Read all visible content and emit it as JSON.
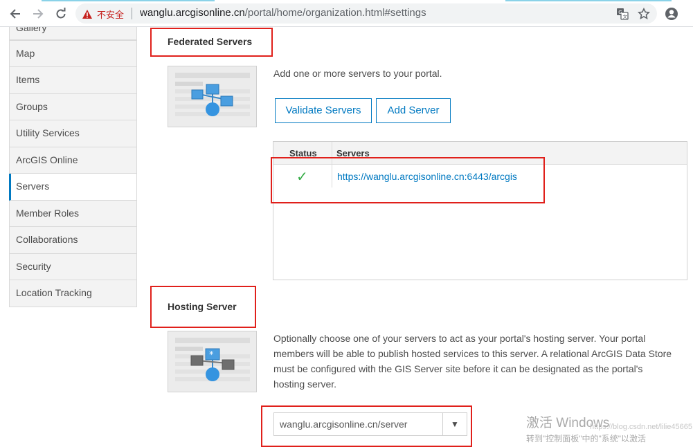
{
  "browser": {
    "security_label": "不安全",
    "url_host": "wanglu.arcgisonline.cn",
    "url_path": "/portal/home/organization.html#settings",
    "icons": [
      "back-icon",
      "forward-icon",
      "reload-icon",
      "warning-icon",
      "translate-icon",
      "star-icon",
      "account-icon"
    ]
  },
  "sidebar": {
    "items": [
      {
        "label": "Gallery"
      },
      {
        "label": "Map"
      },
      {
        "label": "Items"
      },
      {
        "label": "Groups"
      },
      {
        "label": "Utility Services"
      },
      {
        "label": "ArcGIS Online"
      },
      {
        "label": "Servers",
        "active": true
      },
      {
        "label": "Member Roles"
      },
      {
        "label": "Collaborations"
      },
      {
        "label": "Security"
      },
      {
        "label": "Location Tracking"
      }
    ]
  },
  "federated": {
    "title": "Federated Servers",
    "description": "Add one or more servers to your portal.",
    "validate_label": "Validate Servers",
    "add_label": "Add Server",
    "table": {
      "headers": {
        "status": "Status",
        "servers": "Servers"
      },
      "rows": [
        {
          "status": "✓",
          "server": "https://wanglu.arcgisonline.cn:6443/arcgis"
        }
      ]
    }
  },
  "hosting": {
    "title": "Hosting Server",
    "description": "Optionally choose one of your servers to act as your portal's hosting server. Your portal members will be able to publish hosted services to this server. A relational ArcGIS Data Store must be configured with the GIS Server site before it can be designated as the portal's hosting server.",
    "selected_server": "wanglu.arcgisonline.cn/server"
  },
  "watermark": {
    "title": "激活 Windows",
    "subtitle": "转到\"控制面板\"中的\"系统\"以激活",
    "faint": "https://blog.csdn.net/lilie45665"
  },
  "colors": {
    "accent": "#0079c1",
    "highlight_box": "#e0201b",
    "check": "#35ac46"
  }
}
